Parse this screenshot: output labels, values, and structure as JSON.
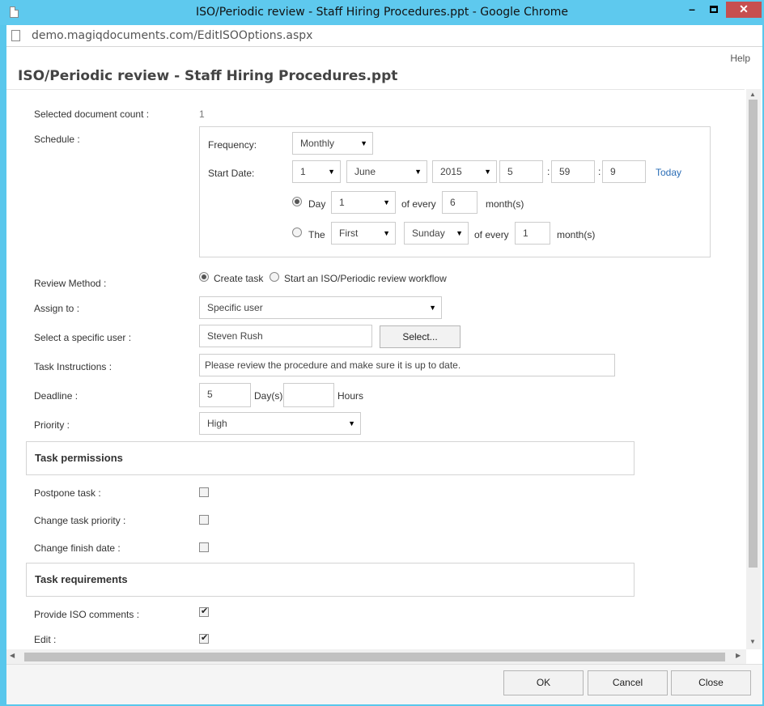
{
  "window": {
    "title": "ISO/Periodic review - Staff Hiring Procedures.ppt - Google Chrome",
    "url": "demo.magiqdocuments.com/EditISOOptions.aspx",
    "min_glyph": "–",
    "close_glyph": "✕"
  },
  "dialog": {
    "help": "Help",
    "title": "ISO/Periodic review - Staff Hiring Procedures.ppt"
  },
  "form": {
    "doc_count_label": "Selected document count :",
    "doc_count_value": "1",
    "schedule_label": "Schedule :",
    "frequency_label": "Frequency:",
    "frequency_value": "Monthly",
    "start_date_label": "Start Date:",
    "start_day": "1",
    "start_month": "June",
    "start_year": "2015",
    "start_hour": "5",
    "start_minute": "59",
    "start_second": "9",
    "time_sep": ":",
    "today_link": "Today",
    "day_option_label": "Day",
    "day_value": "1",
    "of_every": "of every",
    "day_interval": "6",
    "months": "month(s)",
    "the_option_label": "The",
    "ordinal_value": "First",
    "weekday_value": "Sunday",
    "the_interval": "1",
    "review_method_label": "Review Method :",
    "create_task": "Create task",
    "start_workflow": "Start an ISO/Periodic review workflow",
    "assign_to_label": "Assign to :",
    "assign_to_value": "Specific user",
    "select_user_label": "Select a specific user :",
    "user_value": "Steven Rush",
    "select_button": "Select...",
    "task_instructions_label": "Task Instructions :",
    "task_instructions_value": "Please review the procedure and make sure it is up to date.",
    "deadline_label": "Deadline :",
    "deadline_days": "5",
    "days_unit": "Day(s)",
    "deadline_hours": "",
    "hours_unit": "Hours",
    "priority_label": "Priority :",
    "priority_value": "High"
  },
  "task_permissions": {
    "heading": "Task permissions",
    "postpone": "Postpone task :",
    "change_priority": "Change task priority :",
    "change_finish": "Change finish date :"
  },
  "task_requirements": {
    "heading": "Task requirements",
    "iso_comments": "Provide ISO comments :",
    "edit": "Edit :"
  },
  "footer": {
    "ok": "OK",
    "cancel": "Cancel",
    "close": "Close"
  },
  "icons": {
    "dropdown": "▼",
    "check": "✔",
    "scroll_up": "▲",
    "scroll_down": "▼",
    "scroll_left": "◀",
    "scroll_right": "▶"
  }
}
